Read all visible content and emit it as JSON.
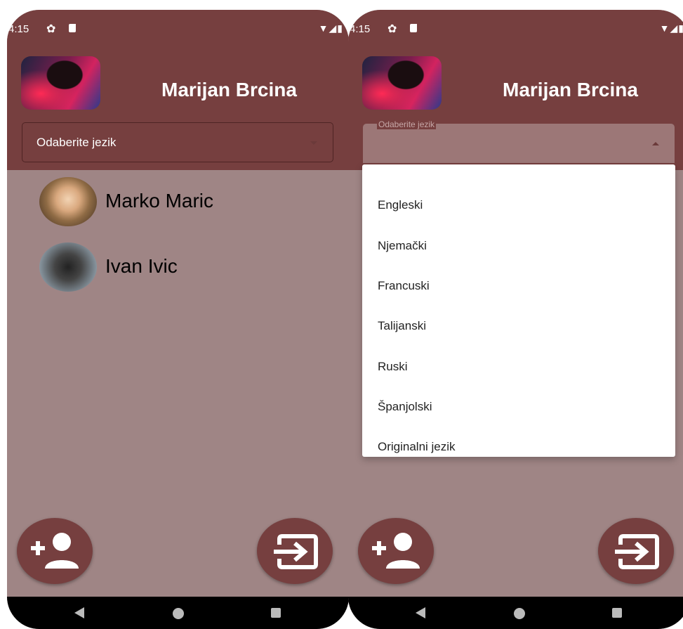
{
  "left_screen": {
    "status_time": "4:15",
    "profile_name": "Marijan Brcina",
    "language_select_label": "Odaberite jezik",
    "contacts": [
      {
        "name": "Marko Maric"
      },
      {
        "name": "Ivan Ivic"
      }
    ]
  },
  "right_screen": {
    "status_time": "4:15",
    "profile_name": "Marijan Brcina",
    "language_select_floating_label": "Odaberite jezik",
    "language_options": [
      "Engleski",
      "Njemački",
      "Francuski",
      "Talijanski",
      "Ruski",
      "Španjolski",
      "Originalni jezik"
    ]
  },
  "icons": {
    "add_contact": "add-person-icon",
    "logout": "exit-icon"
  },
  "colors": {
    "primary": "#763f3f",
    "background": "#9f8585",
    "on_primary": "#ffffff"
  }
}
